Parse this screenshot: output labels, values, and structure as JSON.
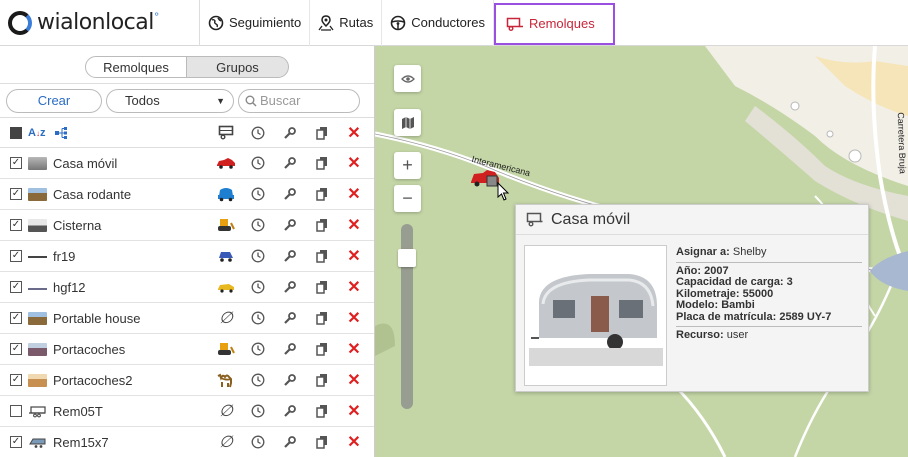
{
  "nav": {
    "logo": "wialonlocal",
    "items": [
      {
        "label": "Seguimiento",
        "icon": "globe-icon"
      },
      {
        "label": "Rutas",
        "icon": "route-icon"
      },
      {
        "label": "Conductores",
        "icon": "steering-wheel-icon"
      },
      {
        "label": "Remolques",
        "icon": "trailer-icon",
        "active": true
      }
    ]
  },
  "sidebar": {
    "tabs": [
      "Remolques",
      "Grupos"
    ],
    "create_label": "Crear",
    "filter_value": "Todos",
    "search_placeholder": "Buscar",
    "rows": [
      {
        "name": "Casa móvil",
        "checked": true
      },
      {
        "name": "Casa rodante",
        "checked": true
      },
      {
        "name": "Cisterna",
        "checked": true
      },
      {
        "name": "fr19",
        "checked": true
      },
      {
        "name": "hgf12",
        "checked": true
      },
      {
        "name": "Portable house",
        "checked": true
      },
      {
        "name": "Portacoches",
        "checked": true
      },
      {
        "name": "Portacoches2",
        "checked": true
      },
      {
        "name": "Rem05T",
        "checked": false
      },
      {
        "name": "Rem15x7",
        "checked": true
      }
    ]
  },
  "map": {
    "road_label": "Interamericana",
    "road_label2": "Carretera Bruja"
  },
  "popup": {
    "title": "Casa móvil",
    "assign_label": "Asignar a:",
    "assign_value": "Shelby",
    "year": "Año: 2007",
    "capacity": "Capacidad de carga: 3",
    "mileage": "Kilometraje: 55000",
    "model": "Modelo: Bambi",
    "plate": "Placa de matrícula: 2589 UY-7",
    "resource_label": "Recurso:",
    "resource_value": "user"
  },
  "colors": {
    "accent_red": "#c8253a",
    "link_blue": "#2b6cc4",
    "active_border": "#9b4fe0",
    "map_green": "#c4d6a6"
  }
}
